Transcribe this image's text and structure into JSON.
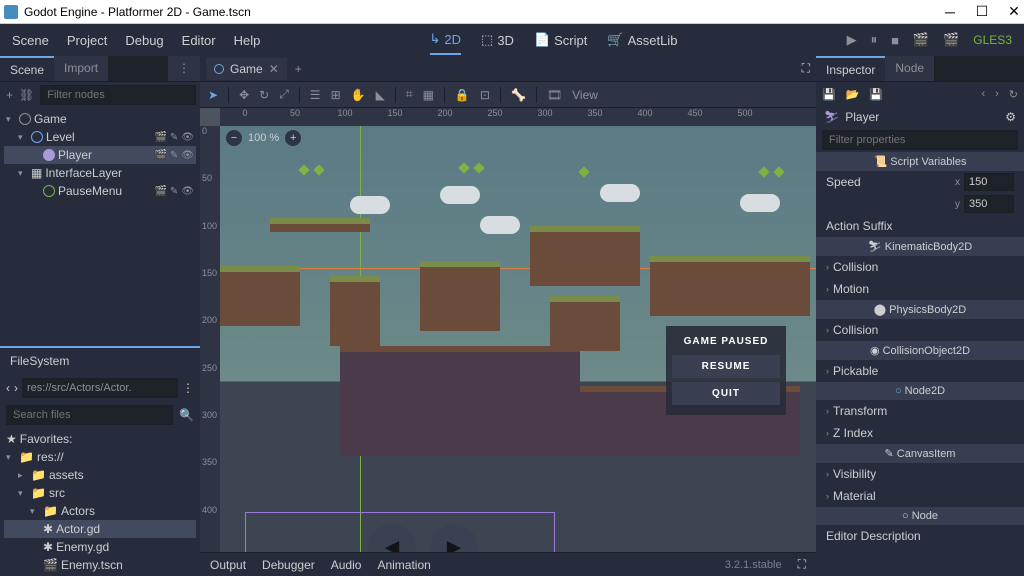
{
  "titlebar": {
    "title": "Godot Engine - Platformer 2D - Game.tscn"
  },
  "menu": {
    "scene": "Scene",
    "project": "Project",
    "debug": "Debug",
    "editor": "Editor",
    "help": "Help"
  },
  "modes": {
    "d2": "2D",
    "d3": "3D",
    "script": "Script",
    "assetlib": "AssetLib"
  },
  "renderer": "GLES3",
  "scene_panel": {
    "tabs": {
      "scene": "Scene",
      "import": "Import"
    },
    "filter_ph": "Filter nodes",
    "nodes": {
      "game": "Game",
      "level": "Level",
      "player": "Player",
      "interface": "InterfaceLayer",
      "pausemenu": "PauseMenu"
    }
  },
  "filesystem": {
    "title": "FileSystem",
    "path": "res://src/Actors/Actor.",
    "search_ph": "Search files",
    "fav": "Favorites:",
    "root": "res://",
    "assets": "assets",
    "src": "src",
    "actors": "Actors",
    "files": {
      "actor_gd": "Actor.gd",
      "enemy_gd": "Enemy.gd",
      "enemy_tscn": "Enemy.tscn"
    }
  },
  "center": {
    "tab": "Game",
    "view_label": "View",
    "zoom": "100 %",
    "pause": {
      "title": "GAME PAUSED",
      "resume": "RESUME",
      "quit": "QUIT"
    },
    "ruler": [
      "0",
      "50",
      "100",
      "150",
      "200",
      "250",
      "300",
      "350",
      "400",
      "450",
      "500"
    ],
    "rulerv": [
      "0",
      "50",
      "100",
      "150",
      "200",
      "250",
      "300",
      "350",
      "400"
    ]
  },
  "bottom": {
    "output": "Output",
    "debugger": "Debugger",
    "audio": "Audio",
    "animation": "Animation",
    "version": "3.2.1.stable"
  },
  "inspector": {
    "tabs": {
      "inspector": "Inspector",
      "node": "Node"
    },
    "node_name": "Player",
    "filter_ph": "Filter properties",
    "sections": {
      "script_vars": "Script Variables",
      "kinematic": "KinematicBody2D",
      "physics": "PhysicsBody2D",
      "collisionobj": "CollisionObject2D",
      "node2d": "Node2D",
      "canvasitem": "CanvasItem",
      "node": "Node"
    },
    "props": {
      "speed": "Speed",
      "x": "x",
      "y": "y",
      "x_val": "150",
      "y_val": "350",
      "action_suffix": "Action Suffix",
      "collision": "Collision",
      "motion": "Motion",
      "pickable": "Pickable",
      "transform": "Transform",
      "zindex": "Z Index",
      "visibility": "Visibility",
      "material": "Material",
      "editor_desc": "Editor Description"
    }
  }
}
